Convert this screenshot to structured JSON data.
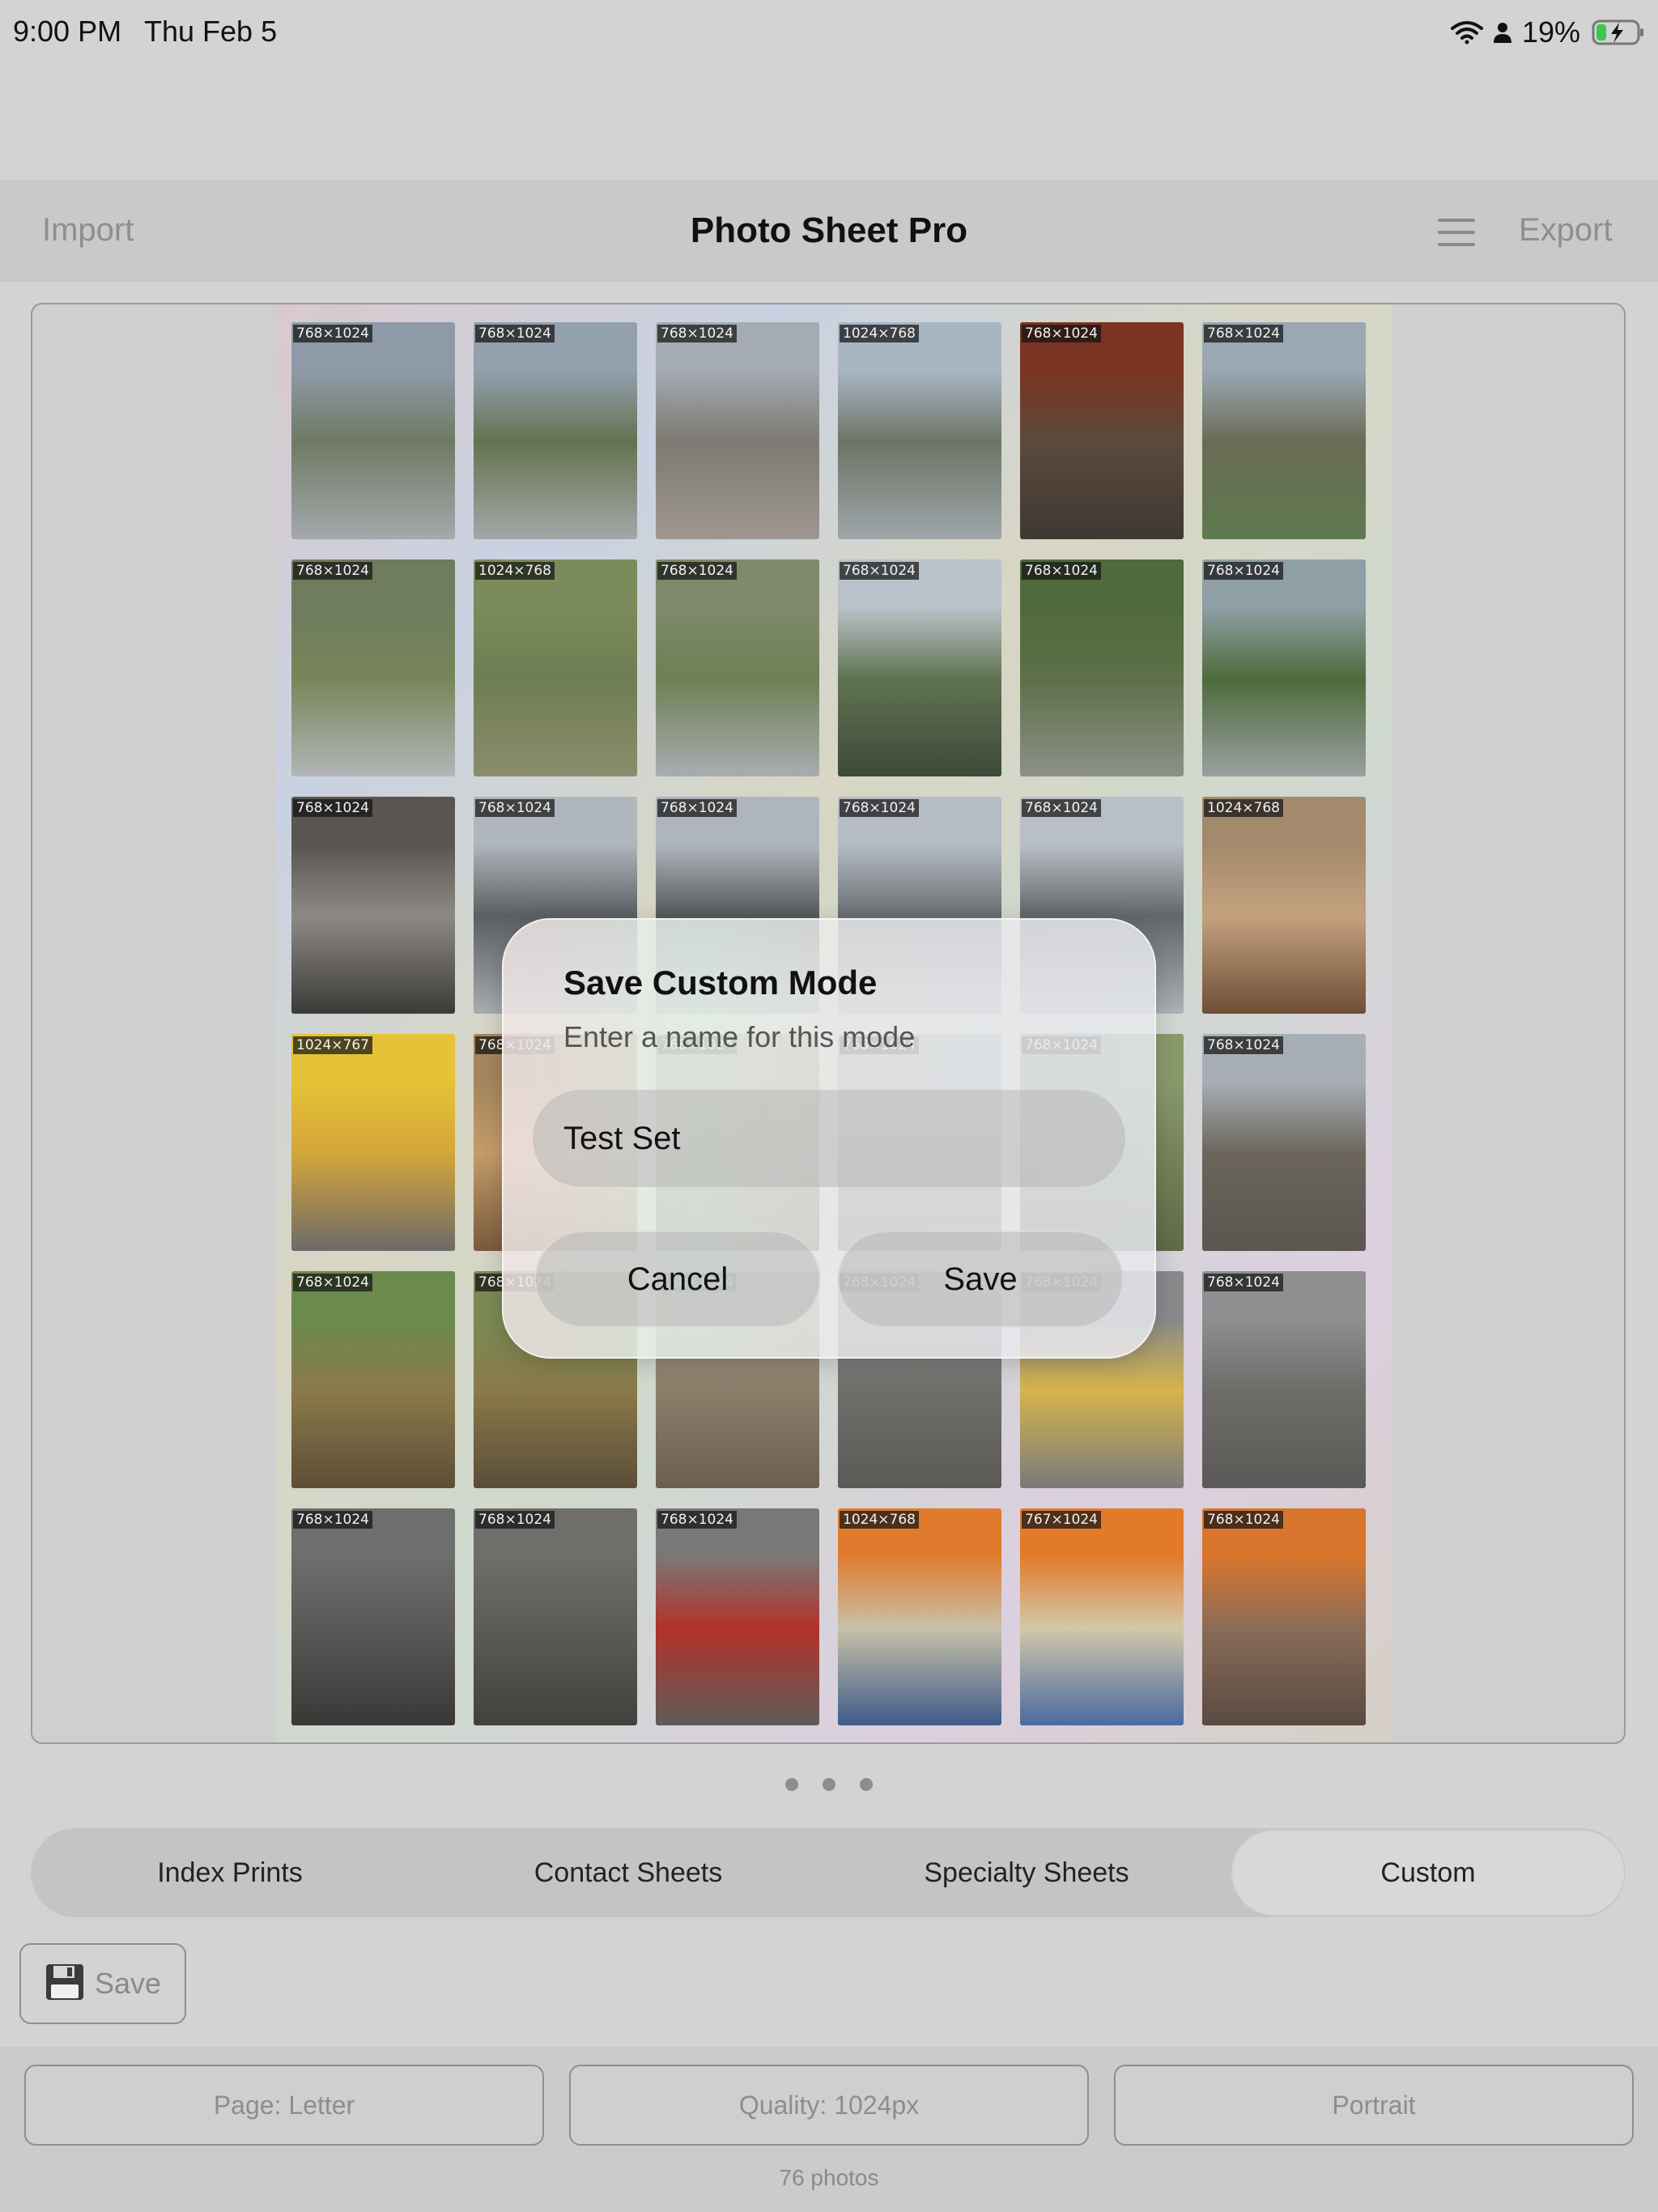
{
  "status_bar": {
    "time": "9:00 PM",
    "date": "Thu Feb 5",
    "battery": "19%"
  },
  "nav": {
    "import_label": "Import",
    "title": "Photo Sheet Pro",
    "export_label": "Export"
  },
  "photos": [
    {
      "label": "768×1024",
      "colors": [
        "#8e9aa8",
        "#6f7a63",
        "#a4a9ad"
      ]
    },
    {
      "label": "768×1024",
      "colors": [
        "#93a0ad",
        "#647251",
        "#a3a7a8"
      ]
    },
    {
      "label": "768×1024",
      "colors": [
        "#a4abb2",
        "#7c7a72",
        "#9f9690"
      ]
    },
    {
      "label": "1024×768",
      "colors": [
        "#a8b6c4",
        "#6d7466",
        "#9ea6aa"
      ]
    },
    {
      "label": "768×1024",
      "colors": [
        "#7b3422",
        "#5b4a3c",
        "#3f3833"
      ]
    },
    {
      "label": "768×1024",
      "colors": [
        "#9aa8b4",
        "#6b6b55",
        "#5e7a4f"
      ]
    },
    {
      "label": "768×1024",
      "colors": [
        "#6f7c5e",
        "#77855a",
        "#b2b6b8"
      ]
    },
    {
      "label": "1024×768",
      "colors": [
        "#7b8b5b",
        "#6e7d52",
        "#8b8d6c"
      ]
    },
    {
      "label": "768×1024",
      "colors": [
        "#7e8a6b",
        "#6f7f55",
        "#a8adb0"
      ]
    },
    {
      "label": "768×1024",
      "colors": [
        "#b9c2ca",
        "#5f7350",
        "#3e4a3b"
      ]
    },
    {
      "label": "768×1024",
      "colors": [
        "#4f6a3d",
        "#5e7048",
        "#8c9089"
      ]
    },
    {
      "label": "768×1024",
      "colors": [
        "#8f9fa5",
        "#4d6b3c",
        "#9aa0a0"
      ]
    },
    {
      "label": "768×1024",
      "colors": [
        "#5a5550",
        "#8d8a85",
        "#3d3b38"
      ]
    },
    {
      "label": "768×1024",
      "colors": [
        "#b0b6bd",
        "#5b5e62",
        "#a8adb2"
      ]
    },
    {
      "label": "768×1024",
      "colors": [
        "#aeb5bc",
        "#56595c",
        "#a3a8ad"
      ]
    },
    {
      "label": "768×1024",
      "colors": [
        "#b5bcc4",
        "#6a6e72",
        "#aab0b6"
      ]
    },
    {
      "label": "768×1024",
      "colors": [
        "#b8bfc6",
        "#626669",
        "#acb2b8"
      ]
    },
    {
      "label": "1024×768",
      "colors": [
        "#a48a6c",
        "#c4a17e",
        "#6e4f36"
      ]
    },
    {
      "label": "1024×767",
      "colors": [
        "#e5c237",
        "#d4a63a",
        "#6c6b6a"
      ]
    },
    {
      "label": "768×1024",
      "colors": [
        "#a6865e",
        "#c49d6a",
        "#7a5a3d"
      ]
    },
    {
      "label": "768×1024",
      "colors": [
        "#a69580",
        "#8a7a66",
        "#6d6052"
      ]
    },
    {
      "label": "768×1024",
      "colors": [
        "#a3a9ad",
        "#8c8b85",
        "#6c6a64"
      ]
    },
    {
      "label": "768×1024",
      "colors": [
        "#8a9a6d",
        "#77855a",
        "#5f6a48"
      ]
    },
    {
      "label": "768×1024",
      "colors": [
        "#a8aeb5",
        "#6b655c",
        "#5b5650"
      ]
    },
    {
      "label": "768×1024",
      "colors": [
        "#6b8a4d",
        "#8b7a4a",
        "#5c4e36"
      ]
    },
    {
      "label": "768×1024",
      "colors": [
        "#7b8a55",
        "#8a7a48",
        "#5a4d38"
      ]
    },
    {
      "label": "768×1024",
      "colors": [
        "#a09380",
        "#8b7e6a",
        "#6a5f50"
      ]
    },
    {
      "label": "768×1024",
      "colors": [
        "#8c8d8e",
        "#6f6e6a",
        "#5b5a57"
      ]
    },
    {
      "label": "768×1024",
      "colors": [
        "#8a8a8c",
        "#d5b44b",
        "#7a7a7c"
      ]
    },
    {
      "label": "768×1024",
      "colors": [
        "#8e8f90",
        "#6e6d6a",
        "#5a5957"
      ]
    },
    {
      "label": "768×1024",
      "colors": [
        "#6e6e6c",
        "#5a5957",
        "#3a3836"
      ]
    },
    {
      "label": "768×1024",
      "colors": [
        "#6f6e6b",
        "#5c5b58",
        "#43413e"
      ]
    },
    {
      "label": "768×1024",
      "colors": [
        "#7a7876",
        "#b3312a",
        "#5e5c59"
      ]
    },
    {
      "label": "1024×768",
      "colors": [
        "#e07b2e",
        "#c8c1a8",
        "#3e5b8a"
      ]
    },
    {
      "label": "767×1024",
      "colors": [
        "#e27a2a",
        "#d3c8a8",
        "#4a6aa0"
      ]
    },
    {
      "label": "768×1024",
      "colors": [
        "#d9752c",
        "#8a6c58",
        "#5a4a42"
      ]
    }
  ],
  "dialog": {
    "title": "Save Custom Mode",
    "subtitle": "Enter a name for this mode",
    "input_value": "Test Set",
    "cancel_label": "Cancel",
    "save_label": "Save"
  },
  "page_dots": 3,
  "tabs": [
    {
      "label": "Index Prints",
      "active": false
    },
    {
      "label": "Contact Sheets",
      "active": false
    },
    {
      "label": "Specialty Sheets",
      "active": false
    },
    {
      "label": "Custom",
      "active": true
    }
  ],
  "save_button": {
    "label": "Save",
    "icon": "floppy-disk-icon"
  },
  "controls": {
    "page": "Page: Letter",
    "quality": "Quality: 1024px",
    "orientation": "Portrait"
  },
  "photo_count": "76 photos"
}
